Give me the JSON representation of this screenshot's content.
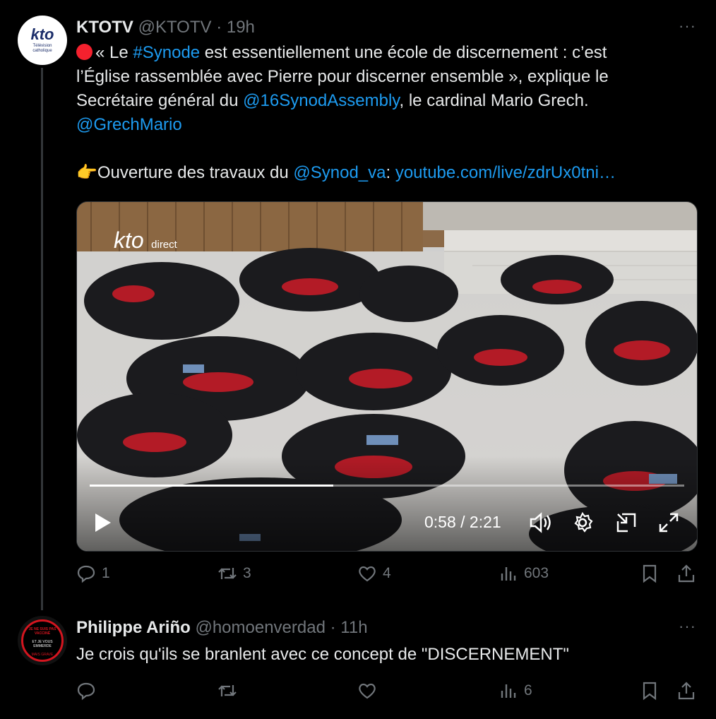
{
  "tweet1": {
    "display_name": "KTOTV",
    "handle": "@KTOTV",
    "separator": "·",
    "time": "19h",
    "more": "···",
    "avatar": {
      "logo_text": "kto",
      "sub1": "Télévision",
      "sub2": "catholique"
    },
    "text": {
      "line1_pre": "« Le ",
      "hashtag": "#Synode",
      "line1_post": " est essentiellement une école de discernement : c’est",
      "line2": "l’Église rassemblée avec Pierre pour discerner ensemble », explique le",
      "line3_pre": "Secrétaire général du ",
      "mention1": "@16SynodAssembly",
      "line3_post": ", le cardinal Mario Grech.",
      "mention2": "@GrechMario",
      "line5_emoji": "👉",
      "line5_pre": "Ouverture des travaux du ",
      "mention3": "@Synod_va",
      "line5_colon": ": ",
      "url": "youtube.com/live/zdrUx0tni…"
    },
    "video": {
      "watermark_logo": "kto",
      "watermark_label": "direct",
      "time_display": "0:58 / 2:21",
      "progress": 0.41
    },
    "actions": {
      "replies": "1",
      "reposts": "3",
      "likes": "4",
      "views": "603"
    }
  },
  "tweet2": {
    "display_name": "Philippe Ariño",
    "handle": "@homoenverdad",
    "separator": "·",
    "time": "11h",
    "more": "···",
    "avatar": {
      "top_text": "JE NE SUIS PAS VACCINÉ",
      "mid1": "ET JE VOUS",
      "mid2": "EMMERDE",
      "bottom": "MAIS GRAVE"
    },
    "text": "Je crois qu'ils se branlent avec ce concept de \"DISCERNEMENT\"",
    "actions": {
      "replies": "",
      "reposts": "",
      "likes": "",
      "views": "6"
    }
  },
  "colors": {
    "background": "#000000",
    "text": "#e7e9ea",
    "secondary": "#71767b",
    "link": "#1d9bf0",
    "live_dot": "#f4212e"
  }
}
